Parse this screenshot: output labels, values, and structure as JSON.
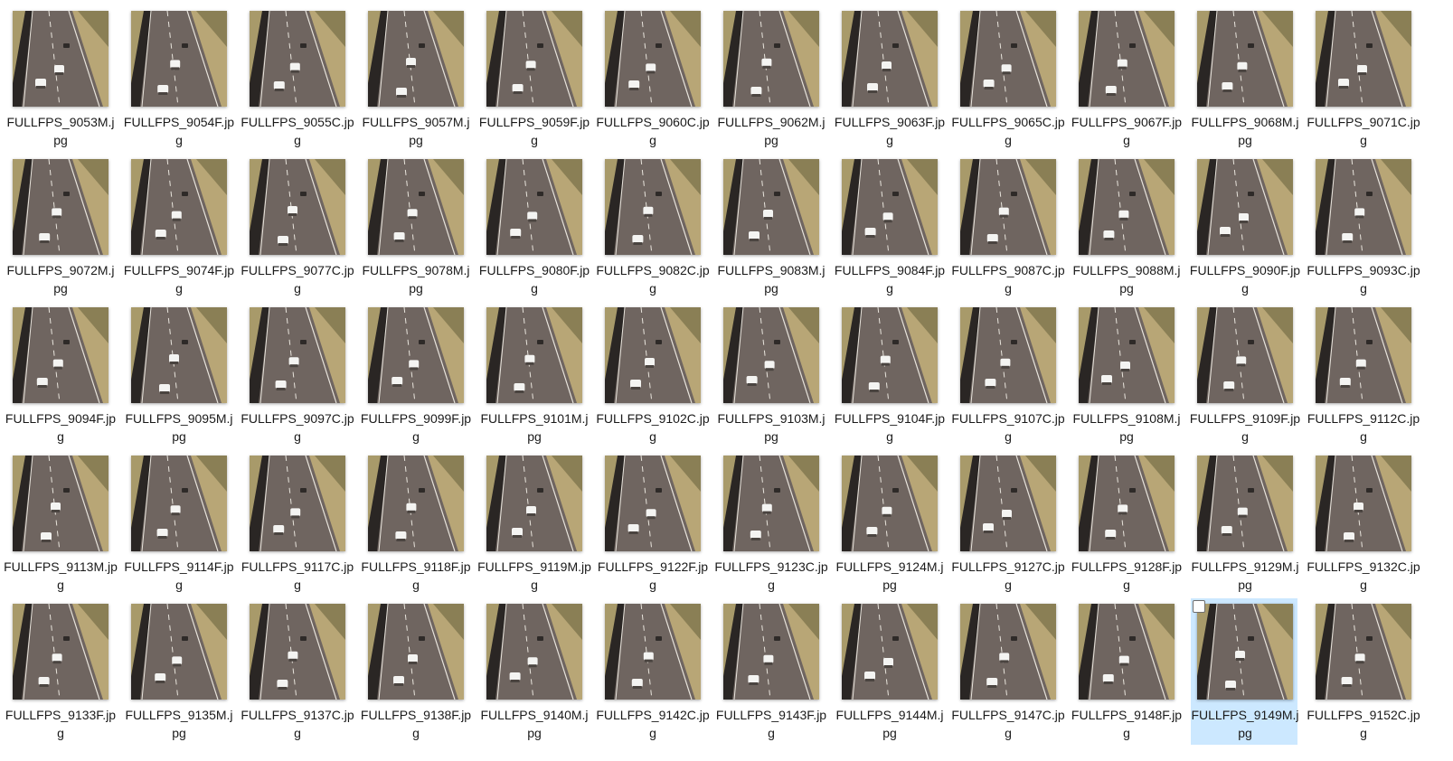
{
  "files": [
    "FULLFPS_9053M.jpg",
    "FULLFPS_9054F.jpg",
    "FULLFPS_9055C.jpg",
    "FULLFPS_9057M.jpg",
    "FULLFPS_9059F.jpg",
    "FULLFPS_9060C.jpg",
    "FULLFPS_9062M.jpg",
    "FULLFPS_9063F.jpg",
    "FULLFPS_9065C.jpg",
    "FULLFPS_9067F.jpg",
    "FULLFPS_9068M.jpg",
    "FULLFPS_9071C.jpg",
    "FULLFPS_9072M.jpg",
    "FULLFPS_9074F.jpg",
    "FULLFPS_9077C.jpg",
    "FULLFPS_9078M.jpg",
    "FULLFPS_9080F.jpg",
    "FULLFPS_9082C.jpg",
    "FULLFPS_9083M.jpg",
    "FULLFPS_9084F.jpg",
    "FULLFPS_9087C.jpg",
    "FULLFPS_9088M.jpg",
    "FULLFPS_9090F.jpg",
    "FULLFPS_9093C.jpg",
    "FULLFPS_9094F.jpg",
    "FULLFPS_9095M.jpg",
    "FULLFPS_9097C.jpg",
    "FULLFPS_9099F.jpg",
    "FULLFPS_9101M.jpg",
    "FULLFPS_9102C.jpg",
    "FULLFPS_9103M.jpg",
    "FULLFPS_9104F.jpg",
    "FULLFPS_9107C.jpg",
    "FULLFPS_9108M.jpg",
    "FULLFPS_9109F.jpg",
    "FULLFPS_9112C.jpg",
    "FULLFPS_9113M.jpg",
    "FULLFPS_9114F.jpg",
    "FULLFPS_9117C.jpg",
    "FULLFPS_9118F.jpg",
    "FULLFPS_9119M.jpg",
    "FULLFPS_9122F.jpg",
    "FULLFPS_9123C.jpg",
    "FULLFPS_9124M.jpg",
    "FULLFPS_9127C.jpg",
    "FULLFPS_9128F.jpg",
    "FULLFPS_9129M.jpg",
    "FULLFPS_9132C.jpg",
    "FULLFPS_9133F.jpg",
    "FULLFPS_9135M.jpg",
    "FULLFPS_9137C.jpg",
    "FULLFPS_9138F.jpg",
    "FULLFPS_9140M.jpg",
    "FULLFPS_9142C.jpg",
    "FULLFPS_9143F.jpg",
    "FULLFPS_9144M.jpg",
    "FULLFPS_9147C.jpg",
    "FULLFPS_9148F.jpg",
    "FULLFPS_9149M.jpg",
    "FULLFPS_9152C.jpg"
  ],
  "selected_file": "FULLFPS_9149M.jpg",
  "thumbnail_icon": "highway-photo-thumbnail",
  "colors": {
    "selection": "#cce8ff",
    "road": "#6f6560",
    "verge": "#a89a6a",
    "median": "#2a2624",
    "car": "#f4f4f2"
  }
}
